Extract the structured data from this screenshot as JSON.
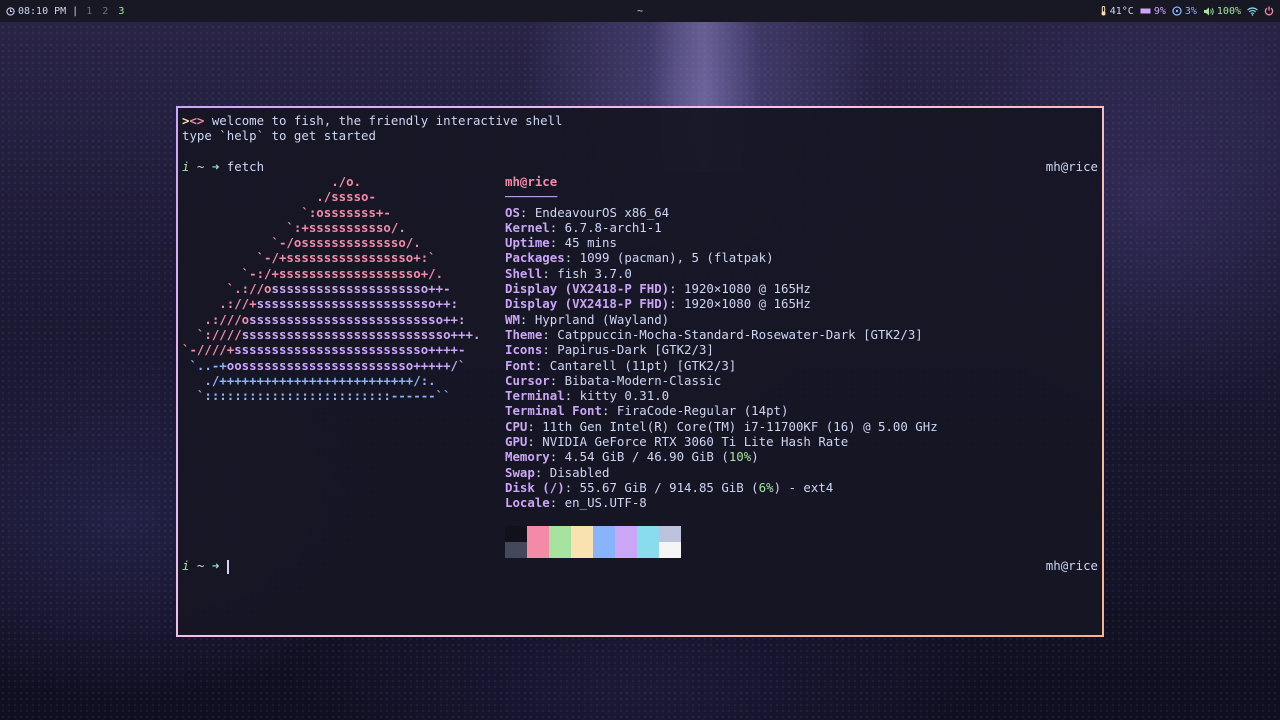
{
  "topbar": {
    "clock_icon": "clock-icon",
    "time": "08:10 PM",
    "separator": "|",
    "workspaces": [
      "1",
      "2",
      "3"
    ],
    "active_workspace": "3",
    "title": "~",
    "stats": {
      "temp": "41°C",
      "cpu": "9%",
      "disk": "3%",
      "volume": "100%"
    },
    "icons": {
      "temp": "thermometer-icon",
      "cpu": "memory-icon",
      "disk": "disk-icon",
      "volume": "volume-icon",
      "wifi": "wifi-icon",
      "power": "power-icon"
    }
  },
  "terminal": {
    "greeting_logo_a": ">",
    "greeting_logo_b": "<>",
    "greeting_line1": " welcome to fish, the friendly interactive shell",
    "greeting_line2": "type `help` to get started",
    "prompt": {
      "i": "i",
      "tilde": " ~ ",
      "arrow": "➜"
    },
    "command": " fetch",
    "hostname": "mh@rice",
    "ascii_art": [
      [
        [
          "p",
          "                    ./o."
        ]
      ],
      [
        [
          "p",
          "                  ./sssso-"
        ]
      ],
      [
        [
          "p",
          "                `:osssssss+-"
        ]
      ],
      [
        [
          "p",
          "              `:+sssssssssso/."
        ]
      ],
      [
        [
          "p",
          "            `-/ossssssssssssso/."
        ]
      ],
      [
        [
          "p",
          "          `-/+sssssssssssssssso+:`"
        ]
      ],
      [
        [
          "p",
          "        `-:/+sssssssssssssssssso+/."
        ]
      ],
      [
        [
          "p",
          "      `.://o"
        ],
        [
          "m",
          "sssssssssssssssssssso++-"
        ]
      ],
      [
        [
          "p",
          "     .://+"
        ],
        [
          "m",
          "ssssssssssssssssssssssso++:"
        ]
      ],
      [
        [
          "p",
          "   .:///o"
        ],
        [
          "m",
          "ssssssssssssssssssssssssso++:"
        ]
      ],
      [
        [
          "p",
          "  `:////"
        ],
        [
          "m",
          "ssssssssssssssssssssssssssso+++."
        ]
      ],
      [
        [
          "p",
          "`-////+"
        ],
        [
          "m",
          "ssssssssssssssssssssssssso++++-"
        ]
      ],
      [
        [
          "b",
          " `..-+"
        ],
        [
          "m",
          "oosssssssssssssssssssssso+++++/`"
        ]
      ],
      [
        [
          "b",
          "   ./++++++++++++++++++++++++++/:."
        ]
      ],
      [
        [
          "b",
          "  `:::::::::::::::::::::::::------``"
        ]
      ]
    ],
    "info": {
      "user": "mh",
      "at": "@",
      "host": "rice",
      "rule": "───────",
      "rows": [
        {
          "key": "OS",
          "value": ": EndeavourOS x86_64"
        },
        {
          "key": "Kernel",
          "value": ": 6.7.8-arch1-1"
        },
        {
          "key": "Uptime",
          "value": ": 45 mins"
        },
        {
          "key": "Packages",
          "value": ": 1099 (pacman), 5 (flatpak)"
        },
        {
          "key": "Shell",
          "value": ": fish 3.7.0"
        },
        {
          "key": "Display (VX2418-P FHD)",
          "value": ": 1920×1080 @ 165Hz"
        },
        {
          "key": "Display (VX2418-P FHD)",
          "value": ": 1920×1080 @ 165Hz"
        },
        {
          "key": "WM",
          "value": ": Hyprland (Wayland)"
        },
        {
          "key": "Theme",
          "value": ": Catppuccin-Mocha-Standard-Rosewater-Dark [GTK2/3]"
        },
        {
          "key": "Icons",
          "value": ": Papirus-Dark [GTK2/3]"
        },
        {
          "key": "Font",
          "value": ": Cantarell (11pt) [GTK2/3]"
        },
        {
          "key": "Cursor",
          "value": ": Bibata-Modern-Classic"
        },
        {
          "key": "Terminal",
          "value": ": kitty 0.31.0"
        },
        {
          "key": "Terminal Font",
          "value": ": FiraCode-Regular (14pt)"
        },
        {
          "key": "CPU",
          "value": ": 11th Gen Intel(R) Core(TM) i7-11700KF (16) @ 5.00 GHz"
        },
        {
          "key": "GPU",
          "value": ": NVIDIA GeForce RTX 3060 Ti Lite Hash Rate"
        },
        {
          "key": "Memory",
          "value": ": 4.54 GiB / 46.90 GiB (",
          "pct": "10%",
          "tail": ")"
        },
        {
          "key": "Swap",
          "value": ": Disabled"
        },
        {
          "key": "Disk (/)",
          "value": ": 55.67 GiB / 914.85 GiB (",
          "pct": "6%",
          "tail": ") - ext4"
        },
        {
          "key": "Locale",
          "value": ": en_US.UTF-8"
        }
      ]
    },
    "palette_top": [
      "#11111b",
      "#f38ba8",
      "#a6e3a1",
      "#f9e2af",
      "#89b4fa",
      "#cba6f7",
      "#89dceb",
      "#bac2de"
    ],
    "palette_bottom": [
      "#45475a",
      "#f38ba8",
      "#a6e3a1",
      "#f9e2af",
      "#89b4fa",
      "#cba6f7",
      "#89dceb",
      "#f5f5f5"
    ]
  }
}
